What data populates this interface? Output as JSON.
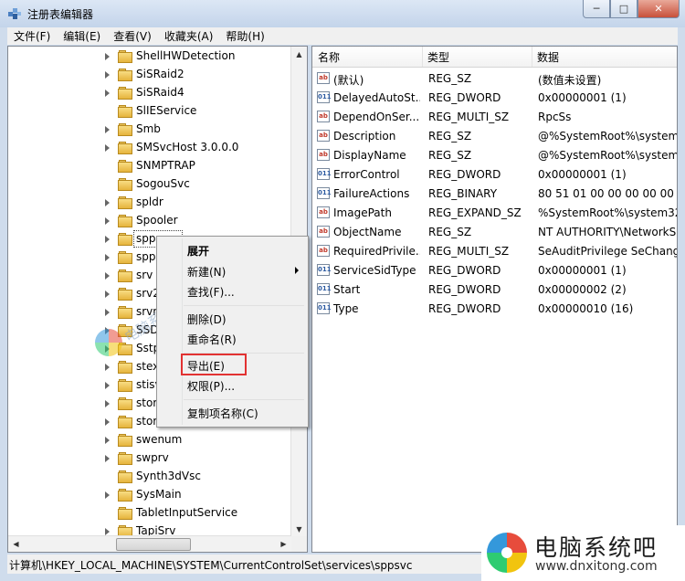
{
  "window": {
    "title": "注册表编辑器"
  },
  "menu": [
    "文件(F)",
    "编辑(E)",
    "查看(V)",
    "收藏夹(A)",
    "帮助(H)"
  ],
  "tree": [
    {
      "label": "ShellHWDetection",
      "expandable": true
    },
    {
      "label": "SiSRaid2",
      "expandable": true
    },
    {
      "label": "SiSRaid4",
      "expandable": true
    },
    {
      "label": "SlIEService",
      "expandable": false
    },
    {
      "label": "Smb",
      "expandable": true
    },
    {
      "label": "SMSvcHost 3.0.0.0",
      "expandable": true
    },
    {
      "label": "SNMPTRAP",
      "expandable": false
    },
    {
      "label": "SogouSvc",
      "expandable": false
    },
    {
      "label": "spldr",
      "expandable": true
    },
    {
      "label": "Spooler",
      "expandable": true
    },
    {
      "label": "spp",
      "expandable": true,
      "selected": true
    },
    {
      "label": "spp",
      "expandable": true
    },
    {
      "label": "srv",
      "expandable": true
    },
    {
      "label": "srv2",
      "expandable": true
    },
    {
      "label": "srvn",
      "expandable": true
    },
    {
      "label": "SSD",
      "expandable": true
    },
    {
      "label": "Sstp",
      "expandable": true
    },
    {
      "label": "stex",
      "expandable": true
    },
    {
      "label": "stisv",
      "expandable": true
    },
    {
      "label": "stor",
      "expandable": true
    },
    {
      "label": "stor",
      "expandable": true
    },
    {
      "label": "swenum",
      "expandable": true
    },
    {
      "label": "swprv",
      "expandable": true
    },
    {
      "label": "Synth3dVsc",
      "expandable": false
    },
    {
      "label": "SysMain",
      "expandable": true
    },
    {
      "label": "TabletInputService",
      "expandable": false
    },
    {
      "label": "TapiSrv",
      "expandable": true
    }
  ],
  "columns": [
    "名称",
    "类型",
    "数据"
  ],
  "values": [
    {
      "name": "(默认)",
      "type": "REG_SZ",
      "data": "(数值未设置)",
      "icon": "string-value-icon"
    },
    {
      "name": "DelayedAutoSt...",
      "type": "REG_DWORD",
      "data": "0x00000001 (1)",
      "icon": "binary-value-icon"
    },
    {
      "name": "DependOnSer...",
      "type": "REG_MULTI_SZ",
      "data": "RpcSs",
      "icon": "string-value-icon"
    },
    {
      "name": "Description",
      "type": "REG_SZ",
      "data": "@%SystemRoot%\\system3",
      "icon": "string-value-icon"
    },
    {
      "name": "DisplayName",
      "type": "REG_SZ",
      "data": "@%SystemRoot%\\system3",
      "icon": "string-value-icon"
    },
    {
      "name": "ErrorControl",
      "type": "REG_DWORD",
      "data": "0x00000001 (1)",
      "icon": "binary-value-icon"
    },
    {
      "name": "FailureActions",
      "type": "REG_BINARY",
      "data": "80 51 01 00 00 00 00 00 0",
      "icon": "binary-value-icon"
    },
    {
      "name": "ImagePath",
      "type": "REG_EXPAND_SZ",
      "data": "%SystemRoot%\\system32\\",
      "icon": "string-value-icon"
    },
    {
      "name": "ObjectName",
      "type": "REG_SZ",
      "data": "NT AUTHORITY\\NetworkS",
      "icon": "string-value-icon"
    },
    {
      "name": "RequiredPrivile...",
      "type": "REG_MULTI_SZ",
      "data": "SeAuditPrivilege SeChange",
      "icon": "string-value-icon"
    },
    {
      "name": "ServiceSidType",
      "type": "REG_DWORD",
      "data": "0x00000001 (1)",
      "icon": "binary-value-icon"
    },
    {
      "name": "Start",
      "type": "REG_DWORD",
      "data": "0x00000002 (2)",
      "icon": "binary-value-icon"
    },
    {
      "name": "Type",
      "type": "REG_DWORD",
      "data": "0x00000010 (16)",
      "icon": "binary-value-icon"
    }
  ],
  "context_menu": {
    "items": [
      {
        "label": "展开",
        "bold": true
      },
      {
        "label": "新建(N)",
        "submenu": true
      },
      {
        "label": "查找(F)..."
      },
      {
        "label": "删除(D)"
      },
      {
        "label": "重命名(R)"
      },
      {
        "label": "导出(E)",
        "highlighted": true
      },
      {
        "label": "权限(P)..."
      },
      {
        "label": "复制项名称(C)"
      }
    ],
    "highlight_color": "#e23232"
  },
  "status": {
    "path": "计算机\\HKEY_LOCAL_MACHINE\\SYSTEM\\CurrentControlSet\\services\\sppsvc"
  },
  "watermark": {
    "text": "电脑系统吧"
  },
  "logo": {
    "text": "电脑系统吧",
    "url": "www.dnxitong.com"
  }
}
